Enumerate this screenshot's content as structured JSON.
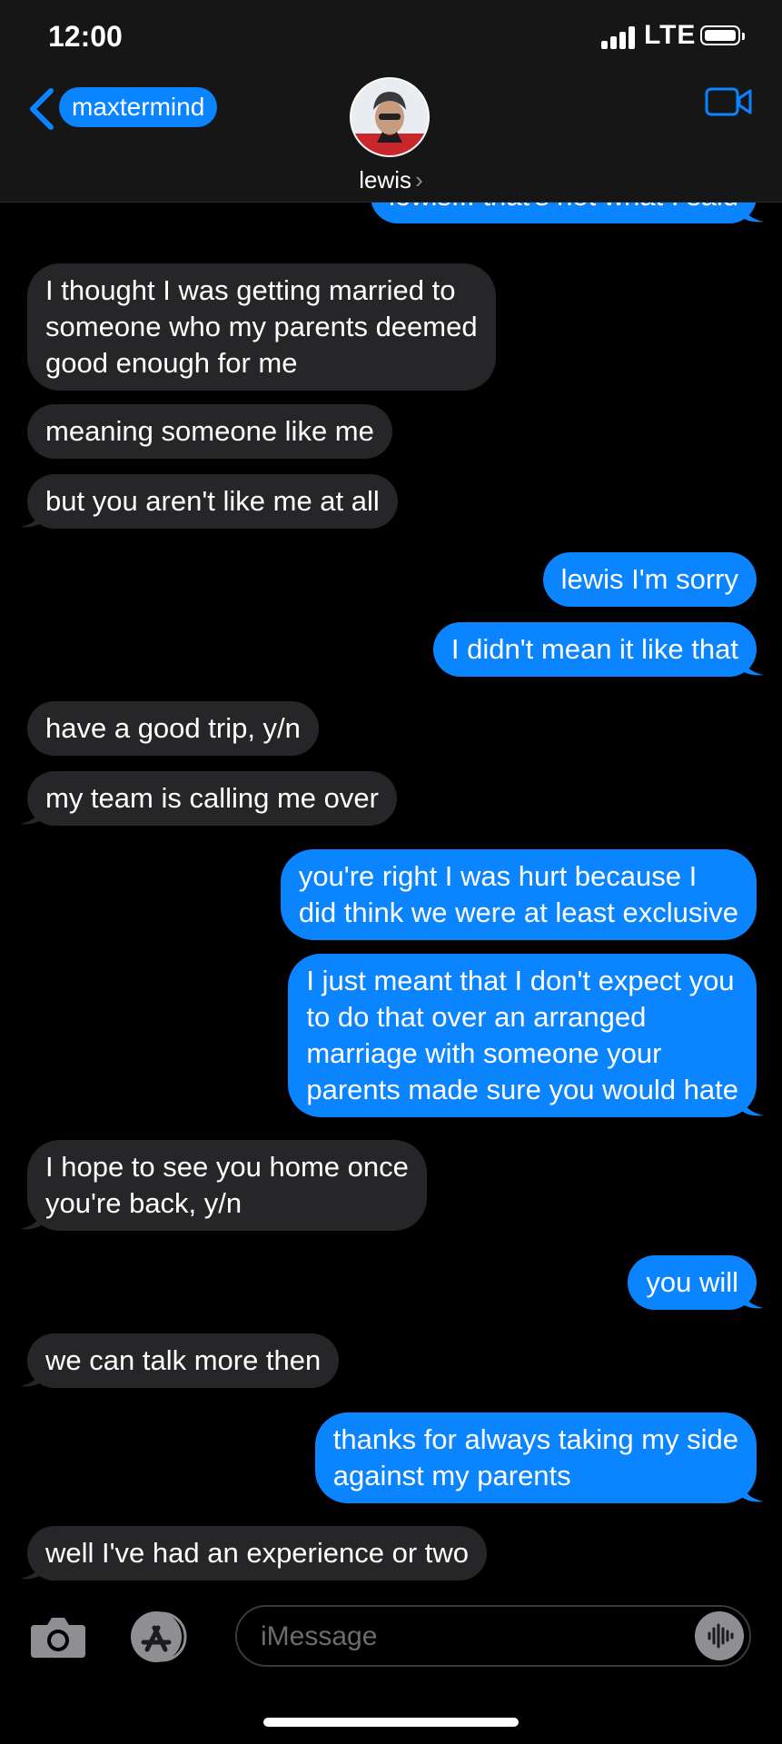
{
  "status": {
    "time": "12:00",
    "network": "LTE"
  },
  "header": {
    "back_label": "maxtermind",
    "contact_name": "lewis"
  },
  "messages": [
    {
      "dir": "out",
      "lines": [
        "lewis... that's not what I said"
      ]
    },
    {
      "dir": "in",
      "lines": [
        "I thought I was getting married to",
        "someone who my parents deemed",
        "good enough for me"
      ]
    },
    {
      "dir": "in",
      "lines": [
        "meaning someone like me"
      ]
    },
    {
      "dir": "in",
      "lines": [
        "but you aren't like me at all"
      ]
    },
    {
      "dir": "out",
      "lines": [
        "lewis I'm sorry"
      ]
    },
    {
      "dir": "out",
      "lines": [
        "I didn't mean it like that"
      ]
    },
    {
      "dir": "in",
      "lines": [
        "have a good trip, y/n"
      ]
    },
    {
      "dir": "in",
      "lines": [
        "my team is calling me over"
      ]
    },
    {
      "dir": "out",
      "lines": [
        "you're right I was hurt because I",
        "did think we were at least exclusive"
      ]
    },
    {
      "dir": "out",
      "lines": [
        "I just meant that I don't expect you",
        "to do that over an arranged",
        "marriage with someone your",
        "parents made sure you would hate"
      ]
    },
    {
      "dir": "in",
      "lines": [
        "I hope to see you home once",
        "you're back, y/n"
      ]
    },
    {
      "dir": "out",
      "lines": [
        "you will"
      ]
    },
    {
      "dir": "in",
      "lines": [
        "we can talk more then"
      ]
    },
    {
      "dir": "out",
      "lines": [
        "thanks for always taking my side",
        "against my parents"
      ]
    },
    {
      "dir": "in",
      "lines": [
        "well I've had an experience or two"
      ]
    }
  ],
  "composer": {
    "placeholder": "iMessage"
  },
  "icons": {
    "back": "chevron-left-icon",
    "video": "video-camera-icon",
    "camera": "camera-icon",
    "apps": "app-store-icon",
    "audio": "audio-waveform-icon"
  },
  "colors": {
    "outgoing": "#0a84ff",
    "incoming": "#262628",
    "background": "#000000"
  }
}
